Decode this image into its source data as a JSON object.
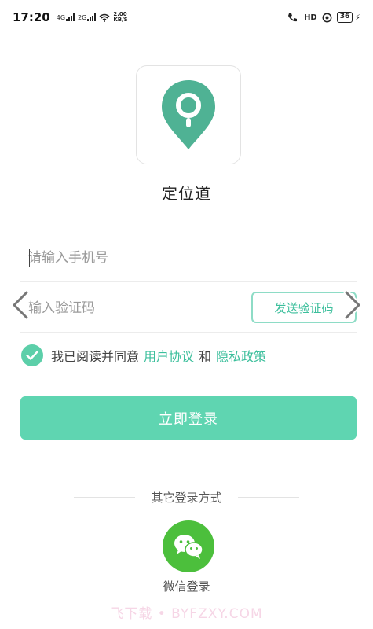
{
  "status_bar": {
    "time": "17:20",
    "signal1_label": "4G",
    "signal2_label": "2G",
    "net_speed_value": "2.00",
    "net_speed_unit": "KB/S",
    "hd_label": "HD",
    "battery_level": "36"
  },
  "app": {
    "name": "定位道",
    "brand_color": "#5fd5b1",
    "logo_icon": "location-pin-icon"
  },
  "form": {
    "phone_placeholder": "请输入手机号",
    "phone_value": "",
    "code_placeholder": "输入验证码",
    "code_value": "",
    "send_code_label": "发送验证码"
  },
  "agreement": {
    "checked": true,
    "prefix": "我已阅读并同意",
    "user_agreement_label": "用户协议",
    "conjunction": "和",
    "privacy_policy_label": "隐私政策"
  },
  "login": {
    "button_label": "立即登录"
  },
  "other_login": {
    "title": "其它登录方式",
    "wechat_label": "微信登录",
    "wechat_icon": "wechat-icon"
  },
  "watermark": {
    "text": "飞下载 • BYFZXY.COM"
  }
}
